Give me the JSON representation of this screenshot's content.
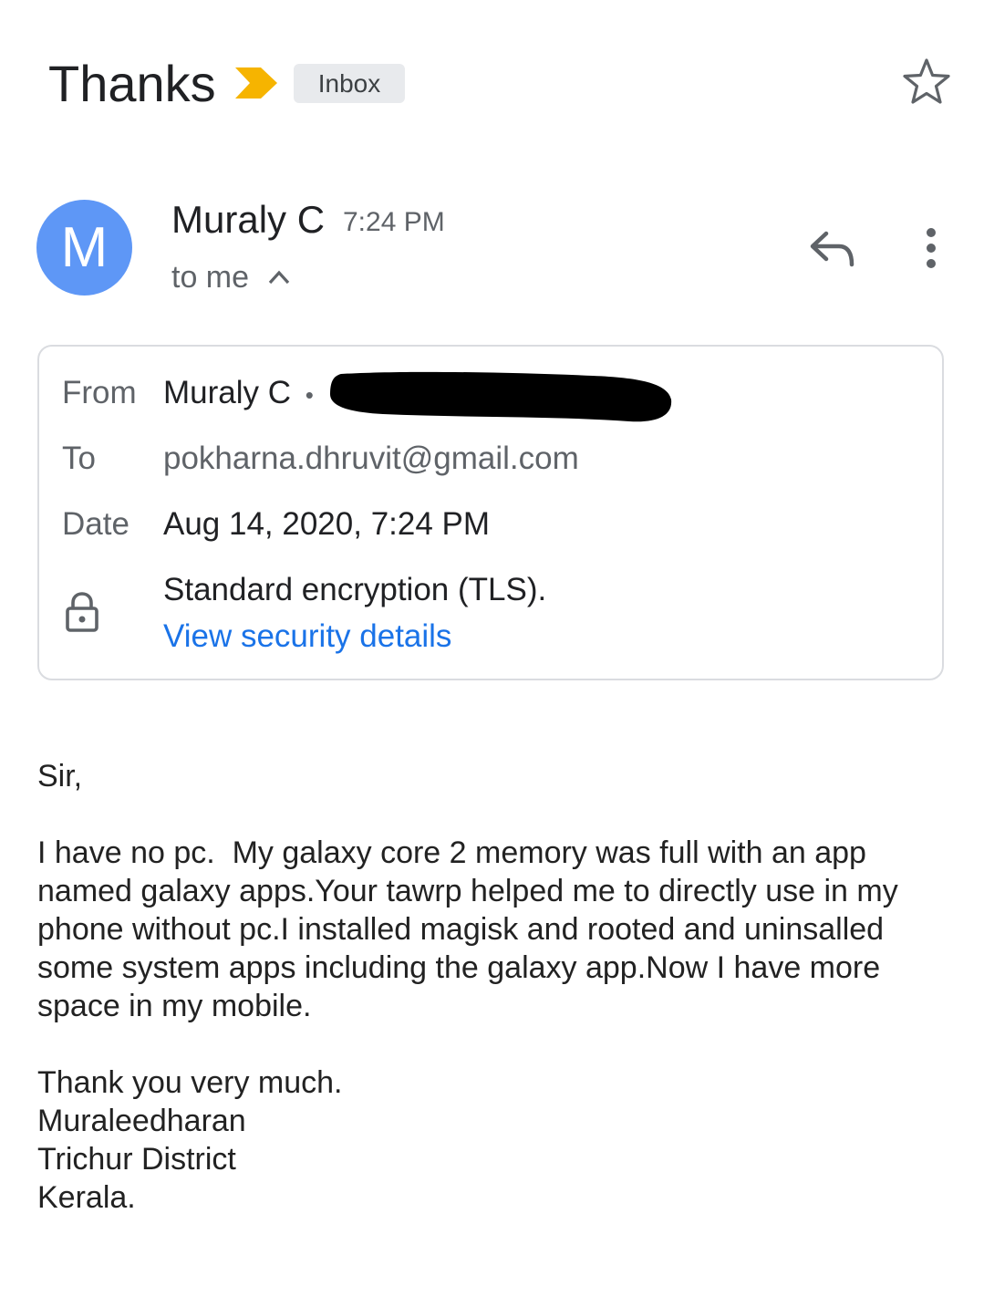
{
  "header": {
    "subject": "Thanks",
    "importance_icon": "importance-marker-icon",
    "importance_color": "#f6b400",
    "label": "Inbox",
    "star_icon": "star-outline-icon"
  },
  "sender": {
    "avatar_letter": "M",
    "avatar_color": "#5e97f6",
    "name": "Muraly C",
    "time": "7:24 PM",
    "recipients": "to me",
    "chevron_icon": "chevron-up-icon",
    "reply_icon": "reply-icon",
    "more_icon": "more-vert-icon"
  },
  "details": {
    "from_label": "From",
    "from_name": "Muraly C",
    "from_separator": "•",
    "to_label": "To",
    "to_value": "pokharna.dhruvit@gmail.com",
    "date_label": "Date",
    "date_value": "Aug 14, 2020, 7:24 PM",
    "lock_icon": "lock-icon",
    "security_text": "Standard encryption (TLS).",
    "security_link": "View security details",
    "link_color": "#1a73e8"
  },
  "body": {
    "greeting": "Sir,",
    "paragraph": "I have no pc.  My galaxy core 2 memory was full with an app named galaxy apps.Your tawrp helped me to directly use in my phone without pc.I installed magisk and rooted and uninsalled some system apps including the galaxy app.Now I have more space in my mobile.",
    "closing": "Thank you very much.",
    "signature_name": "Muraleedharan",
    "signature_district": "Trichur District",
    "signature_state": "Kerala."
  }
}
